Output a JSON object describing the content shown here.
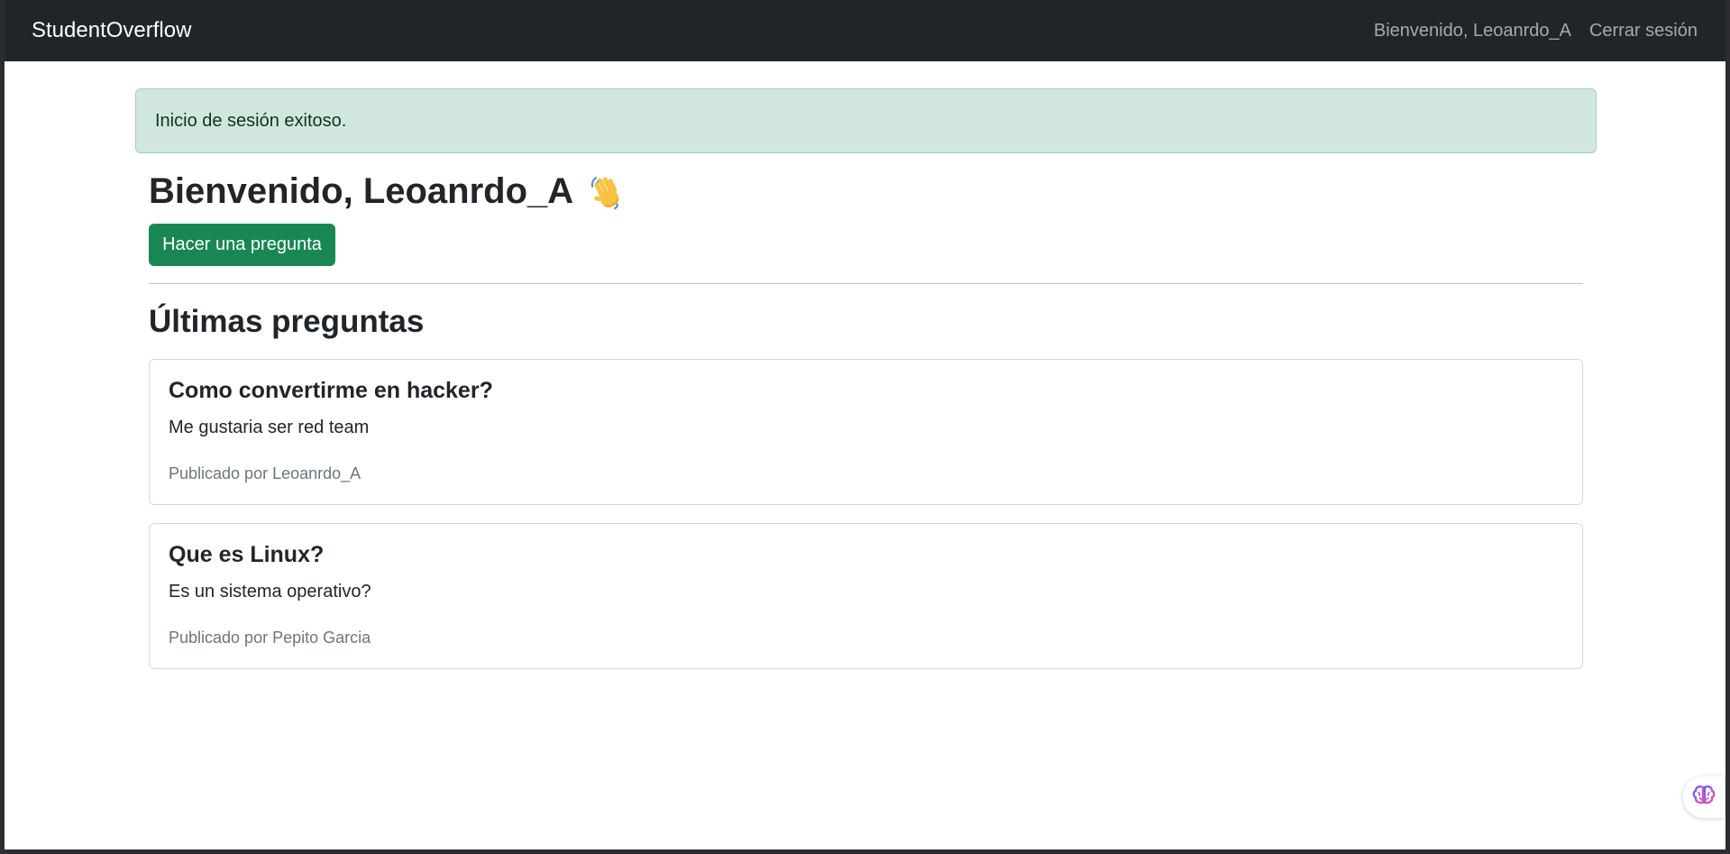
{
  "navbar": {
    "brand": "StudentOverflow",
    "welcome_text": "Bienvenido, Leoanrdo_A",
    "logout_label": "Cerrar sesión"
  },
  "alert": {
    "message": "Inicio de sesión exitoso."
  },
  "welcome": {
    "heading": "Bienvenido, Leoanrdo_A",
    "emoji": "waving-hand-icon"
  },
  "ask_button": {
    "label": "Hacer una pregunta",
    "color": "#198754"
  },
  "questions_section": {
    "title": "Últimas preguntas",
    "items": [
      {
        "title": "Como convertirme en hacker?",
        "body": "Me gustaria ser red team",
        "meta": "Publicado por Leoanrdo_A"
      },
      {
        "title": "Que es Linux?",
        "body": "Es un sistema operativo?",
        "meta": "Publicado por Pepito Garcia"
      }
    ]
  },
  "colors": {
    "navbar_bg": "#212529",
    "alert_bg": "#d1e7dd",
    "alert_text": "#0a3622"
  },
  "floating_assistant": {
    "icon": "brain-icon"
  }
}
